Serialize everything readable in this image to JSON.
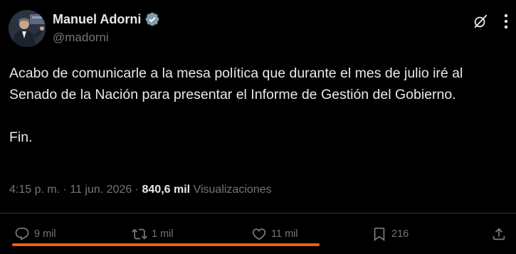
{
  "author": {
    "display_name": "Manuel Adorni",
    "handle": "@madorni",
    "verified": true
  },
  "header_icons": {
    "grok": "grok-slash-icon",
    "more": "more-vertical-icon"
  },
  "tweet": {
    "paragraphs": [
      "Acabo de comunicarle a la mesa política que durante el mes de julio iré al Senado de la Nación para presentar el Informe de Gestión del Gobierno.",
      "Fin."
    ]
  },
  "meta": {
    "time": "4:15 p. m.",
    "separator": "·",
    "date": "11 jun. 2026",
    "views_count": "840,6 mil",
    "views_label": "Visualizaciones"
  },
  "actions": {
    "replies": "9 mil",
    "retweets": "1 mil",
    "likes": "11 mil",
    "bookmarks": "216"
  },
  "colors": {
    "background": "#000000",
    "text_primary": "#e7e9ea",
    "text_secondary": "#71767b",
    "verified_badge": "#829aab",
    "divider": "#2f3336",
    "highlight": "#ff5a0f"
  }
}
